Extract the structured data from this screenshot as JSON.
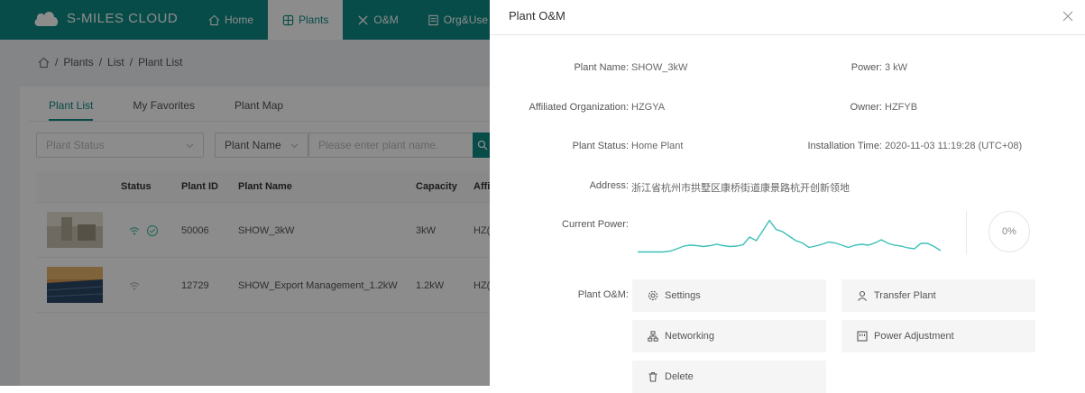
{
  "app": {
    "brand": "S-MILES CLOUD",
    "nav": [
      {
        "label": "Home",
        "icon": "home-icon"
      },
      {
        "label": "Plants",
        "icon": "grid-icon"
      },
      {
        "label": "O&M",
        "icon": "tools-icon"
      },
      {
        "label": "Org&Use",
        "icon": "org-icon"
      }
    ],
    "breadcrumb": [
      "Plants",
      "List",
      "Plant List"
    ],
    "tabs": [
      "Plant List",
      "My Favorites",
      "Plant Map"
    ],
    "filters": {
      "status_placeholder": "Plant Status",
      "name_select": "Plant Name",
      "name_placeholder": "Please enter plant name."
    },
    "table": {
      "headers": [
        "Status",
        "Plant ID",
        "Plant Name",
        "Capacity",
        "Affi"
      ],
      "rows": [
        {
          "id": "50006",
          "name": "SHOW_3kW",
          "capacity": "3kW",
          "org": "HZ("
        },
        {
          "id": "12729",
          "name": "SHOW_Export Management_1.2kW",
          "capacity": "1.2kW",
          "org": "HZ("
        }
      ]
    }
  },
  "drawer": {
    "title": "Plant O&M",
    "fields": {
      "plant_name_label": "Plant Name:",
      "plant_name": "SHOW_3kW",
      "power_label": "Power:",
      "power": "3 kW",
      "org_label": "Affiliated Organization:",
      "org": "HZGYA",
      "owner_label": "Owner:",
      "owner": "HZFYB",
      "status_label": "Plant Status:",
      "status": "Home Plant",
      "install_label": "Installation Time:",
      "install": "2020-11-03 11:19:28 (UTC+08)",
      "address_label": "Address:",
      "address": "浙江省杭州市拱墅区康桥街道康景路杭开创新领地",
      "current_power_label": "Current Power:",
      "percent": "0%",
      "om_label": "Plant O&M:"
    },
    "actions": {
      "settings": "Settings",
      "transfer": "Transfer Plant",
      "networking": "Networking",
      "power_adjust": "Power Adjustment",
      "delete": "Delete"
    },
    "sparkline": [
      0.05,
      0.05,
      0.05,
      0.05,
      0.05,
      0.07,
      0.12,
      0.18,
      0.2,
      0.19,
      0.17,
      0.19,
      0.22,
      0.19,
      0.17,
      0.18,
      0.21,
      0.38,
      0.3,
      0.52,
      0.75,
      0.55,
      0.5,
      0.4,
      0.3,
      0.25,
      0.15,
      0.18,
      0.22,
      0.27,
      0.25,
      0.2,
      0.15,
      0.2,
      0.22,
      0.2,
      0.25,
      0.32,
      0.24,
      0.2,
      0.18,
      0.14,
      0.12,
      0.24,
      0.24,
      0.17,
      0.08
    ],
    "accent": "#0d8a83",
    "line_color": "#3cbfb8"
  }
}
